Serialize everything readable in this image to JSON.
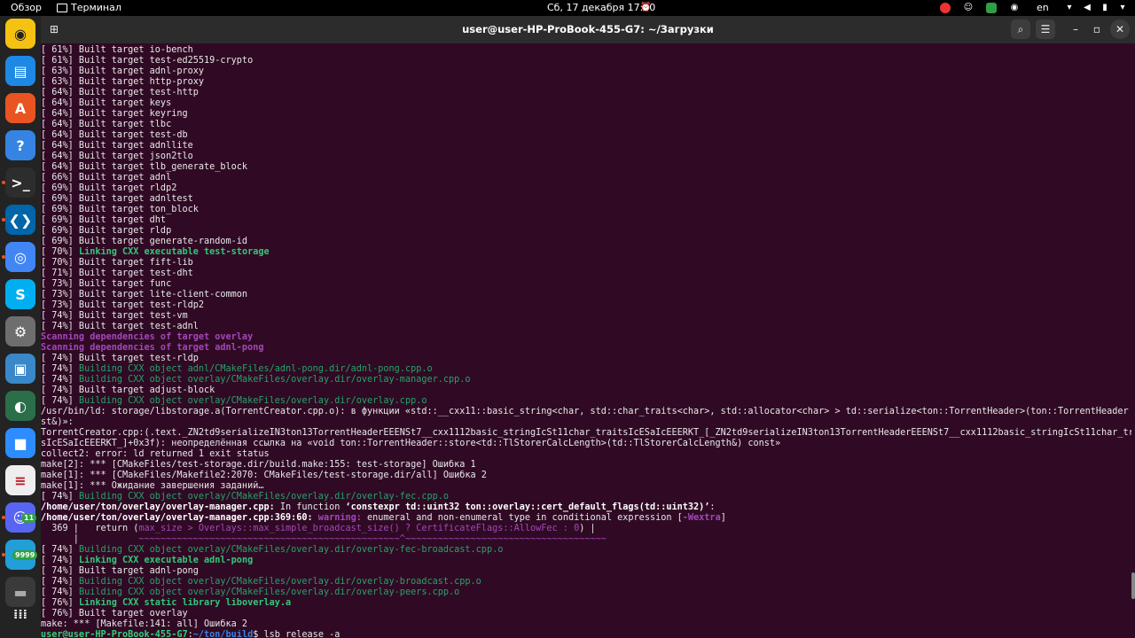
{
  "topbar": {
    "activities": "Обзор",
    "app_name": "Терминал",
    "clock": "Сб, 17 декабря  17:40",
    "lang": "en"
  },
  "dock": {
    "items": [
      {
        "name": "rhythmbox-icon",
        "glyph": "◉",
        "bg": "#f5c211",
        "fg": "#222",
        "running": false
      },
      {
        "name": "libreoffice-writer-icon",
        "glyph": "▤",
        "bg": "#1e88e5",
        "fg": "#fff",
        "running": false
      },
      {
        "name": "ubuntu-software-icon",
        "glyph": "A",
        "bg": "#e95420",
        "fg": "#fff",
        "running": false
      },
      {
        "name": "help-icon",
        "glyph": "?",
        "bg": "#3584e4",
        "fg": "#fff",
        "running": false
      },
      {
        "name": "terminal-icon",
        "glyph": ">_",
        "bg": "#2d2d2d",
        "fg": "#fff",
        "running": true
      },
      {
        "name": "vscode-icon",
        "glyph": "❮❯",
        "bg": "#0065a9",
        "fg": "#fff",
        "running": true
      },
      {
        "name": "chrome-icon",
        "glyph": "◎",
        "bg": "#4285f4",
        "fg": "#fff",
        "running": true
      },
      {
        "name": "skype-icon",
        "glyph": "S",
        "bg": "#00aff0",
        "fg": "#fff",
        "running": false
      },
      {
        "name": "settings-icon",
        "glyph": "⚙",
        "bg": "#6e6e6e",
        "fg": "#fff",
        "running": false
      },
      {
        "name": "screenshot-icon",
        "glyph": "▣",
        "bg": "#3a87c9",
        "fg": "#fff",
        "running": false
      },
      {
        "name": "stellarium-icon",
        "glyph": "◐",
        "bg": "#2a6e4a",
        "fg": "#fff",
        "running": false
      },
      {
        "name": "zoom-icon",
        "glyph": "■",
        "bg": "#2d8cff",
        "fg": "#fff",
        "running": false
      },
      {
        "name": "document-viewer-icon",
        "glyph": "≡",
        "bg": "#eeeeee",
        "fg": "#c01c28",
        "running": false
      },
      {
        "name": "discord-icon",
        "glyph": "☺",
        "bg": "#5865f2",
        "fg": "#fff",
        "running": true
      },
      {
        "name": "telegram-icon",
        "glyph": "➤",
        "bg": "#229ed9",
        "fg": "#fff",
        "running": true
      },
      {
        "name": "trash-icon",
        "glyph": "▬",
        "bg": "#3a3a3a",
        "fg": "#aaa",
        "running": false
      },
      {
        "name": "show-apps-icon",
        "glyph": "⁞⁞⁞",
        "bg": "transparent",
        "fg": "#fff",
        "running": false
      }
    ],
    "discord_badge": "11",
    "telegram_badge": "9999"
  },
  "window": {
    "title": "user@user-HP-ProBook-455-G7: ~/Загрузки"
  },
  "terminal": {
    "lines": [
      [
        {
          "t": "[ 61%] Built target io-bench",
          "c": "white"
        }
      ],
      [
        {
          "t": "[ 61%] Built target test-ed25519-crypto",
          "c": "white"
        }
      ],
      [
        {
          "t": "[ 63%] Built target adnl-proxy",
          "c": "white"
        }
      ],
      [
        {
          "t": "[ 63%] Built target http-proxy",
          "c": "white"
        }
      ],
      [
        {
          "t": "[ 64%] Built target test-http",
          "c": "white"
        }
      ],
      [
        {
          "t": "[ 64%] Built target keys",
          "c": "white"
        }
      ],
      [
        {
          "t": "[ 64%] Built target keyring",
          "c": "white"
        }
      ],
      [
        {
          "t": "[ 64%] Built target tlbc",
          "c": "white"
        }
      ],
      [
        {
          "t": "[ 64%] Built target test-db",
          "c": "white"
        }
      ],
      [
        {
          "t": "[ 64%] Built target adnllite",
          "c": "white"
        }
      ],
      [
        {
          "t": "[ 64%] Built target json2tlo",
          "c": "white"
        }
      ],
      [
        {
          "t": "[ 64%] Built target tlb_generate_block",
          "c": "white"
        }
      ],
      [
        {
          "t": "[ 66%] Built target adnl",
          "c": "white"
        }
      ],
      [
        {
          "t": "[ 69%] Built target rldp2",
          "c": "white"
        }
      ],
      [
        {
          "t": "[ 69%] Built target adnltest",
          "c": "white"
        }
      ],
      [
        {
          "t": "[ 69%] Built target ton_block",
          "c": "white"
        }
      ],
      [
        {
          "t": "[ 69%] Built target dht",
          "c": "white"
        }
      ],
      [
        {
          "t": "[ 69%] Built target rldp",
          "c": "white"
        }
      ],
      [
        {
          "t": "[ 69%] Built target generate-random-id",
          "c": "white"
        }
      ],
      [
        {
          "t": "[ 70%] ",
          "c": "white"
        },
        {
          "t": "Linking CXX executable test-storage",
          "c": "greenb"
        }
      ],
      [
        {
          "t": "[ 70%] Built target fift-lib",
          "c": "white"
        }
      ],
      [
        {
          "t": "[ 71%] Built target test-dht",
          "c": "white"
        }
      ],
      [
        {
          "t": "[ 73%] Built target func",
          "c": "white"
        }
      ],
      [
        {
          "t": "[ 73%] Built target lite-client-common",
          "c": "white"
        }
      ],
      [
        {
          "t": "[ 73%] Built target test-rldp2",
          "c": "white"
        }
      ],
      [
        {
          "t": "[ 74%] Built target test-vm",
          "c": "white"
        }
      ],
      [
        {
          "t": "[ 74%] Built target test-adnl",
          "c": "white"
        }
      ],
      [
        {
          "t": "Scanning dependencies of target overlay",
          "c": "purpleb"
        }
      ],
      [
        {
          "t": "Scanning dependencies of target adnl-pong",
          "c": "purpleb"
        }
      ],
      [
        {
          "t": "[ 74%] Built target test-rldp",
          "c": "white"
        }
      ],
      [
        {
          "t": "[ 74%] ",
          "c": "white"
        },
        {
          "t": "Building CXX object adnl/CMakeFiles/adnl-pong.dir/adnl-pong.cpp.o",
          "c": "green"
        }
      ],
      [
        {
          "t": "[ 74%] ",
          "c": "white"
        },
        {
          "t": "Building CXX object overlay/CMakeFiles/overlay.dir/overlay-manager.cpp.o",
          "c": "green"
        }
      ],
      [
        {
          "t": "[ 74%] Built target adjust-block",
          "c": "white"
        }
      ],
      [
        {
          "t": "[ 74%] ",
          "c": "white"
        },
        {
          "t": "Building CXX object overlay/CMakeFiles/overlay.dir/overlay.cpp.o",
          "c": "green"
        }
      ],
      [
        {
          "t": "/usr/bin/ld: storage/libstorage.a(TorrentCreator.cpp.o): в функции «std::__cxx11::basic_string<char, std::char_traits<char>, std::allocator<char> > td::serialize<ton::TorrentHeader>(ton::TorrentHeader con",
          "c": "white"
        }
      ],
      [
        {
          "t": "st&)»:",
          "c": "white"
        }
      ],
      [
        {
          "t": "TorrentCreator.cpp:(.text._ZN2td9serializeIN3ton13TorrentHeaderEEENSt7__cxx1112basic_stringIcSt11char_traitsIcESaIcEEERKT_[_ZN2td9serializeIN3ton13TorrentHeaderEEENSt7__cxx1112basic_stringIcSt11char_trait",
          "c": "white"
        }
      ],
      [
        {
          "t": "sIcESaIcEEERKT_]+0x3f): неопределённая ссылка на «void ton::TorrentHeader::store<td::TlStorerCalcLength>(td::TlStorerCalcLength&) const»",
          "c": "white"
        }
      ],
      [
        {
          "t": "collect2: error: ld returned 1 exit status",
          "c": "white"
        }
      ],
      [
        {
          "t": "make[2]: *** [CMakeFiles/test-storage.dir/build.make:155: test-storage] Ошибка 1",
          "c": "white"
        }
      ],
      [
        {
          "t": "make[1]: *** [CMakeFiles/Makefile2:2070: CMakeFiles/test-storage.dir/all] Ошибка 2",
          "c": "white"
        }
      ],
      [
        {
          "t": "make[1]: *** Ожидание завершения заданий…",
          "c": "white"
        }
      ],
      [
        {
          "t": "[ 74%] ",
          "c": "white"
        },
        {
          "t": "Building CXX object overlay/CMakeFiles/overlay.dir/overlay-fec.cpp.o",
          "c": "green"
        }
      ],
      [
        {
          "t": "/home/user/ton/overlay/overlay-manager.cpp:",
          "c": "bold"
        },
        {
          "t": " In function ",
          "c": "white"
        },
        {
          "t": "‘constexpr td::uint32 ton::overlay::cert_default_flags(td::uint32)’",
          "c": "bold"
        },
        {
          "t": ":",
          "c": "white"
        }
      ],
      [
        {
          "t": "/home/user/ton/overlay/overlay-manager.cpp:369:60:",
          "c": "bold"
        },
        {
          "t": " warning: ",
          "c": "warn"
        },
        {
          "t": "enumeral and non-enumeral type in conditional expression [",
          "c": "white"
        },
        {
          "t": "-Wextra",
          "c": "warn"
        },
        {
          "t": "]",
          "c": "white"
        }
      ],
      [
        {
          "t": "  369 |   return (",
          "c": "white"
        },
        {
          "t": "max_size > Overlays::max_simple_broadcast_size() ? CertificateFlags::AllowFec : 0",
          "c": "purple"
        },
        {
          "t": ") |",
          "c": "white"
        }
      ],
      [
        {
          "t": "      |           ",
          "c": "white"
        },
        {
          "t": "~~~~~~~~~~~~~~~~~~~~~~~~~~~~~~~~~~~~~~~~~~~~~~~~^~~~~~~~~~~~~~~~~~~~~~~~~~~~~~~~~~~~~~",
          "c": "purple"
        }
      ],
      [
        {
          "t": "[ 74%] ",
          "c": "white"
        },
        {
          "t": "Building CXX object overlay/CMakeFiles/overlay.dir/overlay-fec-broadcast.cpp.o",
          "c": "green"
        }
      ],
      [
        {
          "t": "[ 74%] ",
          "c": "white"
        },
        {
          "t": "Linking CXX executable adnl-pong",
          "c": "greenb"
        }
      ],
      [
        {
          "t": "[ 74%] Built target adnl-pong",
          "c": "white"
        }
      ],
      [
        {
          "t": "[ 74%] ",
          "c": "white"
        },
        {
          "t": "Building CXX object overlay/CMakeFiles/overlay.dir/overlay-broadcast.cpp.o",
          "c": "green"
        }
      ],
      [
        {
          "t": "[ 74%] ",
          "c": "white"
        },
        {
          "t": "Building CXX object overlay/CMakeFiles/overlay.dir/overlay-peers.cpp.o",
          "c": "green"
        }
      ],
      [
        {
          "t": "[ 76%] ",
          "c": "white"
        },
        {
          "t": "Linking CXX static library liboverlay.a",
          "c": "greenb"
        }
      ],
      [
        {
          "t": "[ 76%] Built target overlay",
          "c": "white"
        }
      ],
      [
        {
          "t": "make: *** [Makefile:141: all] Ошибка 2",
          "c": "white"
        }
      ],
      [
        {
          "t": "user@user-HP-ProBook-455-G7",
          "c": "promptuser"
        },
        {
          "t": ":",
          "c": "white"
        },
        {
          "t": "~/ton/build",
          "c": "promptpath"
        },
        {
          "t": "$ lsb_release -a",
          "c": "white"
        }
      ]
    ]
  }
}
